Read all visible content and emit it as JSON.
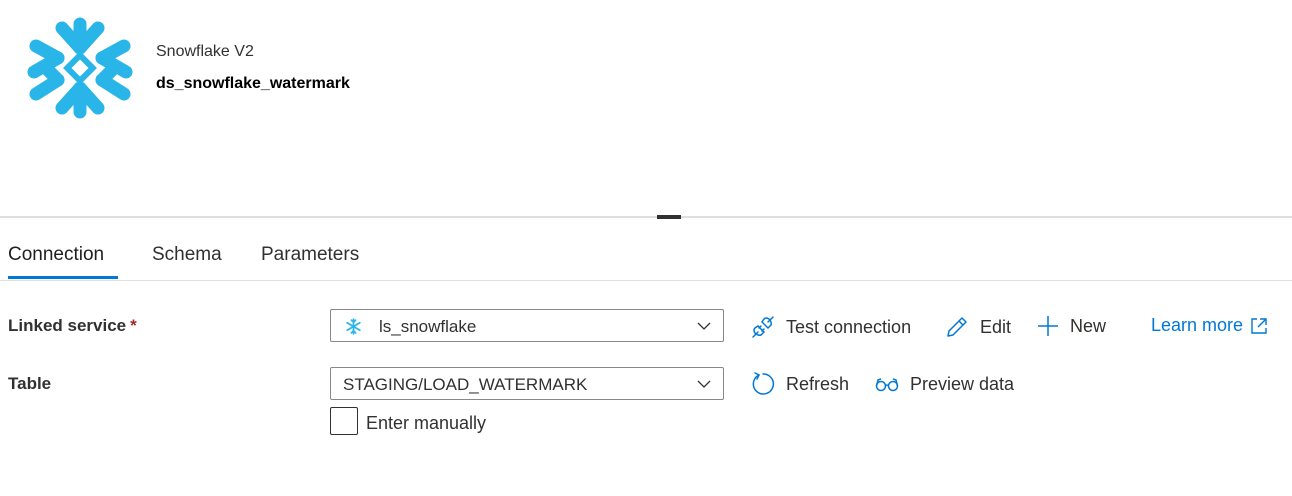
{
  "dataset": {
    "type_label": "Snowflake V2",
    "name": "ds_snowflake_watermark"
  },
  "tabs": [
    {
      "label": "Connection",
      "active": true
    },
    {
      "label": "Schema",
      "active": false
    },
    {
      "label": "Parameters",
      "active": false
    }
  ],
  "linked_service": {
    "label": "Linked service",
    "required_marker": "*",
    "value": "ls_snowflake",
    "icon": "snowflake-icon",
    "actions": {
      "test_connection": "Test connection",
      "edit": "Edit",
      "new": "New",
      "learn_more": "Learn more"
    }
  },
  "table": {
    "label": "Table",
    "value": "STAGING/LOAD_WATERMARK",
    "actions": {
      "refresh": "Refresh",
      "preview": "Preview data"
    },
    "enter_manually": {
      "label": "Enter manually",
      "checked": false
    }
  },
  "colors": {
    "brand_snowflake": "#29b5e8",
    "accent": "#0078d4",
    "required": "#a4262c"
  }
}
